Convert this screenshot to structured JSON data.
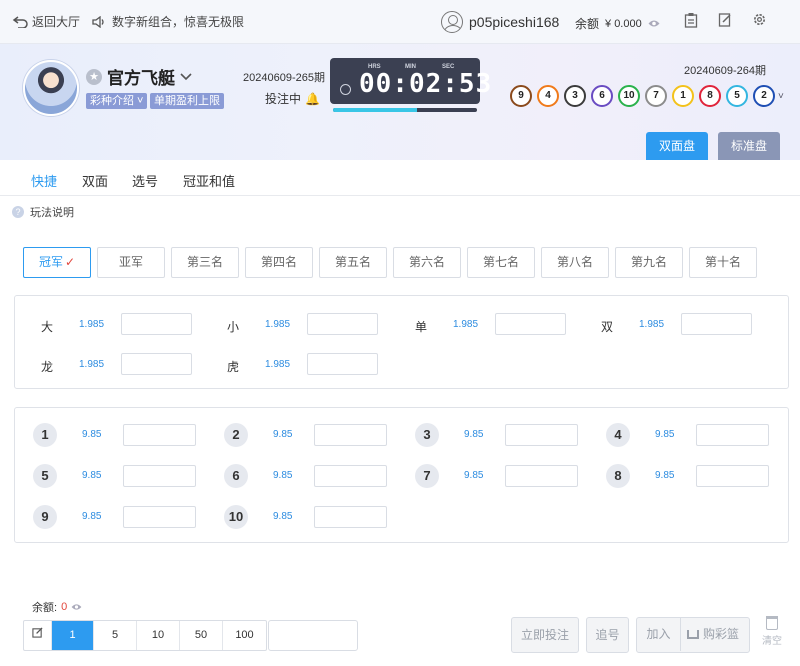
{
  "topbar": {
    "back_label": "返回大厅",
    "announcement": "数字新组合，惊喜无极限",
    "username": "p05piceshi168",
    "balance_label": "余额",
    "balance_value": "¥ 0.000"
  },
  "game": {
    "title": "官方飞艇",
    "tags": [
      "彩种介绍",
      "单期盈利上限"
    ],
    "current_period": "20240609-265期",
    "status": "投注中",
    "timer": {
      "hrs_label": "HRS",
      "min_label": "MIN",
      "sec_label": "SEC",
      "display": "00:02:53",
      "progress": 0.58
    },
    "last_period": "20240609-264期",
    "last_results": [
      {
        "n": "9",
        "color": "#8b4a1c"
      },
      {
        "n": "4",
        "color": "#f07a1a"
      },
      {
        "n": "3",
        "color": "#3b3b3b"
      },
      {
        "n": "6",
        "color": "#6a4cc2"
      },
      {
        "n": "10",
        "color": "#2bb24c"
      },
      {
        "n": "7",
        "color": "#8c8c8c"
      },
      {
        "n": "1",
        "color": "#f3c21b"
      },
      {
        "n": "8",
        "color": "#e0243b"
      },
      {
        "n": "5",
        "color": "#33b6e0"
      },
      {
        "n": "2",
        "color": "#1f4fb4"
      }
    ],
    "mode_tabs": [
      "双面盘",
      "标准盘"
    ]
  },
  "subnav": [
    "快捷",
    "双面",
    "选号",
    "冠亚和值"
  ],
  "rules_label": "玩法说明",
  "positions": [
    "冠军",
    "亚军",
    "第三名",
    "第四名",
    "第五名",
    "第六名",
    "第七名",
    "第八名",
    "第九名",
    "第十名"
  ],
  "two_sided": [
    {
      "name": "大",
      "odds": "1.985"
    },
    {
      "name": "小",
      "odds": "1.985"
    },
    {
      "name": "单",
      "odds": "1.985"
    },
    {
      "name": "双",
      "odds": "1.985"
    },
    {
      "name": "龙",
      "odds": "1.985"
    },
    {
      "name": "虎",
      "odds": "1.985"
    }
  ],
  "numbers": [
    {
      "name": "1",
      "odds": "9.85"
    },
    {
      "name": "2",
      "odds": "9.85"
    },
    {
      "name": "3",
      "odds": "9.85"
    },
    {
      "name": "4",
      "odds": "9.85"
    },
    {
      "name": "5",
      "odds": "9.85"
    },
    {
      "name": "6",
      "odds": "9.85"
    },
    {
      "name": "7",
      "odds": "9.85"
    },
    {
      "name": "8",
      "odds": "9.85"
    },
    {
      "name": "9",
      "odds": "9.85"
    },
    {
      "name": "10",
      "odds": "9.85"
    }
  ],
  "bottom": {
    "balance_label": "余额:",
    "balance_value": "0",
    "chips": [
      "1",
      "5",
      "10",
      "50",
      "100"
    ],
    "bet_now": "立即投注",
    "chase": "追号",
    "add": "加入",
    "cart": "购彩篮",
    "clear": "清空"
  },
  "colors": {
    "accent": "#2d9bf0",
    "timer_bg": "#3b4052",
    "mode_inactive": "#8a96b6"
  }
}
